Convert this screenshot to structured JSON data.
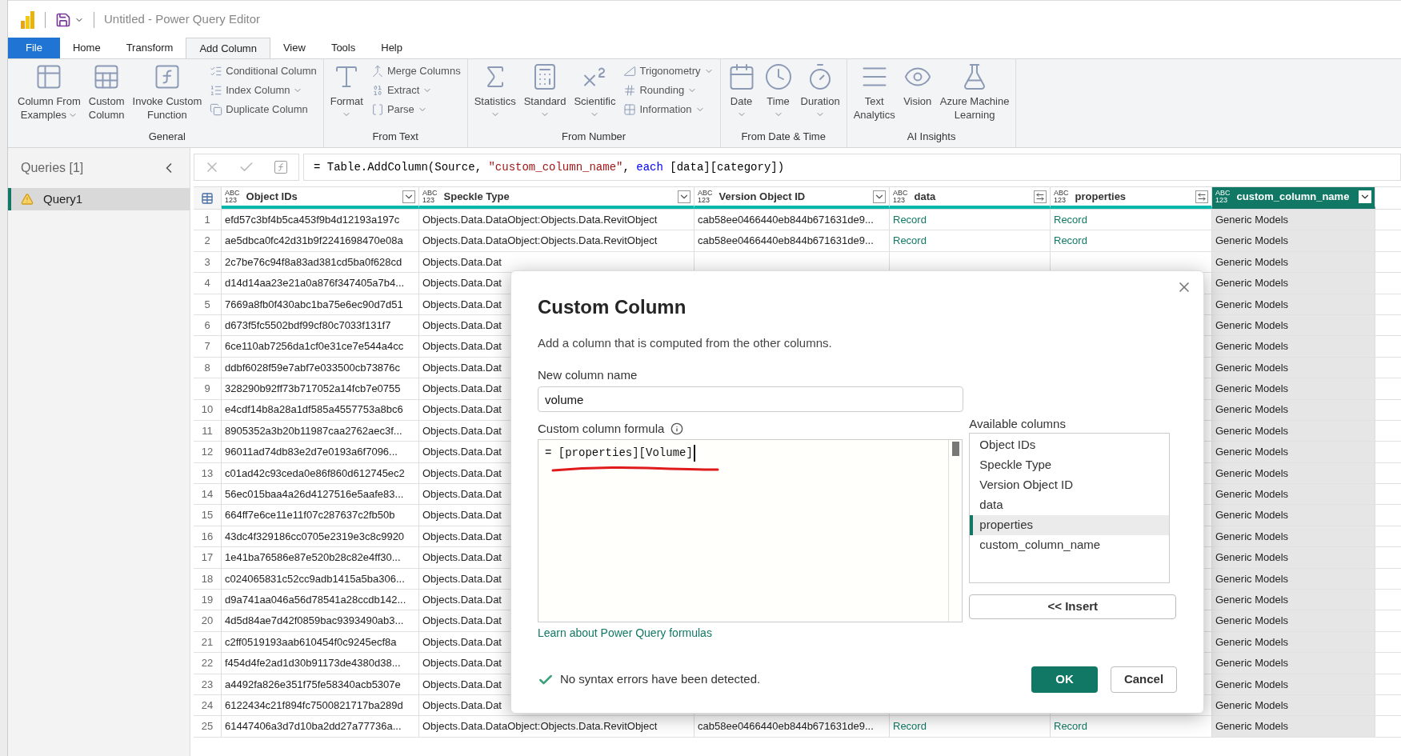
{
  "window": {
    "title": "Untitled - Power Query Editor"
  },
  "menu_tabs": [
    {
      "label": "File",
      "kind": "file",
      "selected": false
    },
    {
      "label": "Home",
      "kind": "tab",
      "selected": false
    },
    {
      "label": "Transform",
      "kind": "tab",
      "selected": false
    },
    {
      "label": "Add Column",
      "kind": "tab",
      "selected": true
    },
    {
      "label": "View",
      "kind": "tab",
      "selected": false
    },
    {
      "label": "Tools",
      "kind": "tab",
      "selected": false
    },
    {
      "label": "Help",
      "kind": "tab",
      "selected": false
    }
  ],
  "ribbon_groups": [
    {
      "label": "General",
      "items": [
        {
          "kind": "large",
          "lines": [
            "Column From",
            "Examples"
          ],
          "dropdown": true
        },
        {
          "kind": "large",
          "lines": [
            "Custom",
            "Column"
          ],
          "dropdown": false
        },
        {
          "kind": "large",
          "lines": [
            "Invoke Custom",
            "Function"
          ],
          "dropdown": false
        },
        {
          "kind": "small",
          "label": "Conditional Column",
          "dropdown": false
        },
        {
          "kind": "small",
          "label": "Index Column",
          "dropdown": true
        },
        {
          "kind": "small",
          "label": "Duplicate Column",
          "dropdown": false
        }
      ]
    },
    {
      "label": "From Text",
      "items": [
        {
          "kind": "large",
          "lines": [
            "Format"
          ],
          "dropdown": true
        },
        {
          "kind": "small",
          "label": "Merge Columns",
          "dropdown": false
        },
        {
          "kind": "small",
          "label": "Extract",
          "dropdown": true
        },
        {
          "kind": "small",
          "label": "Parse",
          "dropdown": true
        }
      ]
    },
    {
      "label": "From Number",
      "items": [
        {
          "kind": "large",
          "lines": [
            "Statistics"
          ],
          "dropdown": true
        },
        {
          "kind": "large",
          "lines": [
            "Standard"
          ],
          "dropdown": true
        },
        {
          "kind": "large",
          "lines": [
            "Scientific"
          ],
          "dropdown": true
        },
        {
          "kind": "small",
          "label": "Trigonometry",
          "dropdown": true
        },
        {
          "kind": "small",
          "label": "Rounding",
          "dropdown": true
        },
        {
          "kind": "small",
          "label": "Information",
          "dropdown": true
        }
      ]
    },
    {
      "label": "From Date & Time",
      "items": [
        {
          "kind": "large",
          "lines": [
            "Date"
          ],
          "dropdown": true
        },
        {
          "kind": "large",
          "lines": [
            "Time"
          ],
          "dropdown": true
        },
        {
          "kind": "large",
          "lines": [
            "Duration"
          ],
          "dropdown": true
        }
      ]
    },
    {
      "label": "AI Insights",
      "items": [
        {
          "kind": "large",
          "lines": [
            "Text",
            "Analytics"
          ],
          "dropdown": false
        },
        {
          "kind": "large",
          "lines": [
            "Vision"
          ],
          "dropdown": false
        },
        {
          "kind": "large",
          "lines": [
            "Azure Machine",
            "Learning"
          ],
          "dropdown": false
        }
      ]
    }
  ],
  "queries_pane": {
    "title": "Queries [1]",
    "items": [
      {
        "label": "Query1",
        "selected": true,
        "warning": true
      }
    ]
  },
  "formula_bar": {
    "segments": [
      {
        "kind": "plain",
        "text": "= Table.AddColumn(Source, "
      },
      {
        "kind": "string",
        "text": "\"custom_column_name\""
      },
      {
        "kind": "plain",
        "text": ", "
      },
      {
        "kind": "keyword",
        "text": "each"
      },
      {
        "kind": "plain",
        "text": " [data][category])"
      }
    ]
  },
  "table": {
    "columns": [
      {
        "name": "Object IDs",
        "type": [
          "ABC",
          "123"
        ],
        "kind": "text",
        "selected": false
      },
      {
        "name": "Speckle Type",
        "type": [
          "ABC",
          "123"
        ],
        "kind": "text",
        "selected": false
      },
      {
        "name": "Version Object ID",
        "type": [
          "ABC",
          "123"
        ],
        "kind": "text",
        "selected": false
      },
      {
        "name": "data",
        "type": [
          "ABC",
          "123"
        ],
        "kind": "record",
        "selected": false
      },
      {
        "name": "properties",
        "type": [
          "ABC",
          "123"
        ],
        "kind": "record",
        "selected": false
      },
      {
        "name": "custom_column_name",
        "type": [
          "ABC",
          "123"
        ],
        "kind": "text",
        "selected": true
      }
    ],
    "rows": [
      {
        "number": "1",
        "cells": [
          "efd57c3bf4b5ca453f9b4d12193a197c",
          "Objects.Data.DataObject:Objects.Data.RevitObject",
          "cab58ee0466440eb844b671631de9...",
          "Record",
          "Record",
          "Generic Models"
        ]
      },
      {
        "number": "2",
        "cells": [
          "ae5dbca0fc42d31b9f2241698470e08a",
          "Objects.Data.DataObject:Objects.Data.RevitObject",
          "cab58ee0466440eb844b671631de9...",
          "Record",
          "Record",
          "Generic Models"
        ]
      },
      {
        "number": "3",
        "cells": [
          "2c7be76c94f8a83ad381cd5ba0f628cd",
          "Objects.Data.Dat",
          null,
          null,
          null,
          "Generic Models"
        ]
      },
      {
        "number": "4",
        "cells": [
          "d14d14aa23e21a0a876f347405a7b4...",
          "Objects.Data.Dat",
          null,
          null,
          null,
          "Generic Models"
        ]
      },
      {
        "number": "5",
        "cells": [
          "7669a8fb0f430abc1ba75e6ec90d7d51",
          "Objects.Data.Dat",
          null,
          null,
          null,
          "Generic Models"
        ]
      },
      {
        "number": "6",
        "cells": [
          "d673f5fc5502bdf99cf80c7033f131f7",
          "Objects.Data.Dat",
          null,
          null,
          null,
          "Generic Models"
        ]
      },
      {
        "number": "7",
        "cells": [
          "6ce110ab7256da1cf0e31ce7e544a4cc",
          "Objects.Data.Dat",
          null,
          null,
          null,
          "Generic Models"
        ]
      },
      {
        "number": "8",
        "cells": [
          "ddbf6028f59e7abf7e033500cb73876c",
          "Objects.Data.Dat",
          null,
          null,
          null,
          "Generic Models"
        ]
      },
      {
        "number": "9",
        "cells": [
          "328290b92ff73b717052a14fcb7e0755",
          "Objects.Data.Dat",
          null,
          null,
          null,
          "Generic Models"
        ]
      },
      {
        "number": "10",
        "cells": [
          "e4cdf14b8a28a1df585a4557753a8bc6",
          "Objects.Data.Dat",
          null,
          null,
          null,
          "Generic Models"
        ]
      },
      {
        "number": "11",
        "cells": [
          "8905352a3b20b11987caa2762aec3f...",
          "Objects.Data.Dat",
          null,
          null,
          null,
          "Generic Models"
        ]
      },
      {
        "number": "12",
        "cells": [
          "96011ad74db83e2d7e0193a6f7096...",
          "Objects.Data.Dat",
          null,
          null,
          null,
          "Generic Models"
        ]
      },
      {
        "number": "13",
        "cells": [
          "c01ad42c93ceda0e86f860d612745ec2",
          "Objects.Data.Dat",
          null,
          null,
          null,
          "Generic Models"
        ]
      },
      {
        "number": "14",
        "cells": [
          "56ec015baa4a26d4127516e5aafe83...",
          "Objects.Data.Dat",
          null,
          null,
          null,
          "Generic Models"
        ]
      },
      {
        "number": "15",
        "cells": [
          "664ff7e6ce11e11f07c287637c2fb50b",
          "Objects.Data.Dat",
          null,
          null,
          null,
          "Generic Models"
        ]
      },
      {
        "number": "16",
        "cells": [
          "43dc4f329186cc0705e2319e3c8c9920",
          "Objects.Data.Dat",
          null,
          null,
          null,
          "Generic Models"
        ]
      },
      {
        "number": "17",
        "cells": [
          "1e41ba76586e87e520b28c82e4ff30...",
          "Objects.Data.Dat",
          null,
          null,
          null,
          "Generic Models"
        ]
      },
      {
        "number": "18",
        "cells": [
          "c024065831c52cc9adb1415a5ba306...",
          "Objects.Data.Dat",
          null,
          null,
          null,
          "Generic Models"
        ]
      },
      {
        "number": "19",
        "cells": [
          "d9a741aa046a56d78541a28ccdb142...",
          "Objects.Data.Dat",
          null,
          null,
          null,
          "Generic Models"
        ]
      },
      {
        "number": "20",
        "cells": [
          "4d5d84ae7d42f0859bac9393490ab3...",
          "Objects.Data.Dat",
          null,
          null,
          null,
          "Generic Models"
        ]
      },
      {
        "number": "21",
        "cells": [
          "c2ff0519193aab610454f0c9245ecf8a",
          "Objects.Data.Dat",
          null,
          null,
          null,
          "Generic Models"
        ]
      },
      {
        "number": "22",
        "cells": [
          "f454d4fe2ad1d30b91173de4380d38...",
          "Objects.Data.Dat",
          null,
          null,
          null,
          "Generic Models"
        ]
      },
      {
        "number": "23",
        "cells": [
          "a4492fa826e351f75fe58340acb5307e",
          "Objects.Data.Dat",
          null,
          null,
          null,
          "Generic Models"
        ]
      },
      {
        "number": "24",
        "cells": [
          "6122434c21f894fc7500821717ba289d",
          "Objects.Data.Dat",
          null,
          null,
          null,
          "Generic Models"
        ]
      },
      {
        "number": "25",
        "cells": [
          "61447406a3d7d10ba2dd27a77736a...",
          "Objects.Data.DataObject:Objects.Data.RevitObject",
          "cab58ee0466440eb844b671631de9...",
          "Record",
          "Record",
          "Generic Models"
        ]
      }
    ]
  },
  "dialog": {
    "title": "Custom Column",
    "description": "Add a column that is computed from the other columns.",
    "name_label": "New column name",
    "name_value": "volume",
    "formula_label": "Custom column formula",
    "formula": "= [properties][Volume]",
    "available_label": "Available columns",
    "available_columns": [
      {
        "label": "Object IDs",
        "selected": false
      },
      {
        "label": "Speckle Type",
        "selected": false
      },
      {
        "label": "Version Object ID",
        "selected": false
      },
      {
        "label": "data",
        "selected": false
      },
      {
        "label": "properties",
        "selected": true
      },
      {
        "label": "custom_column_name",
        "selected": false
      }
    ],
    "insert_button": "<< Insert",
    "learn_link": "Learn about Power Query formulas",
    "status": "No syntax errors have been detected.",
    "buttons": [
      {
        "label": "OK",
        "kind": "primary"
      },
      {
        "label": "Cancel",
        "kind": "secondary"
      }
    ]
  }
}
